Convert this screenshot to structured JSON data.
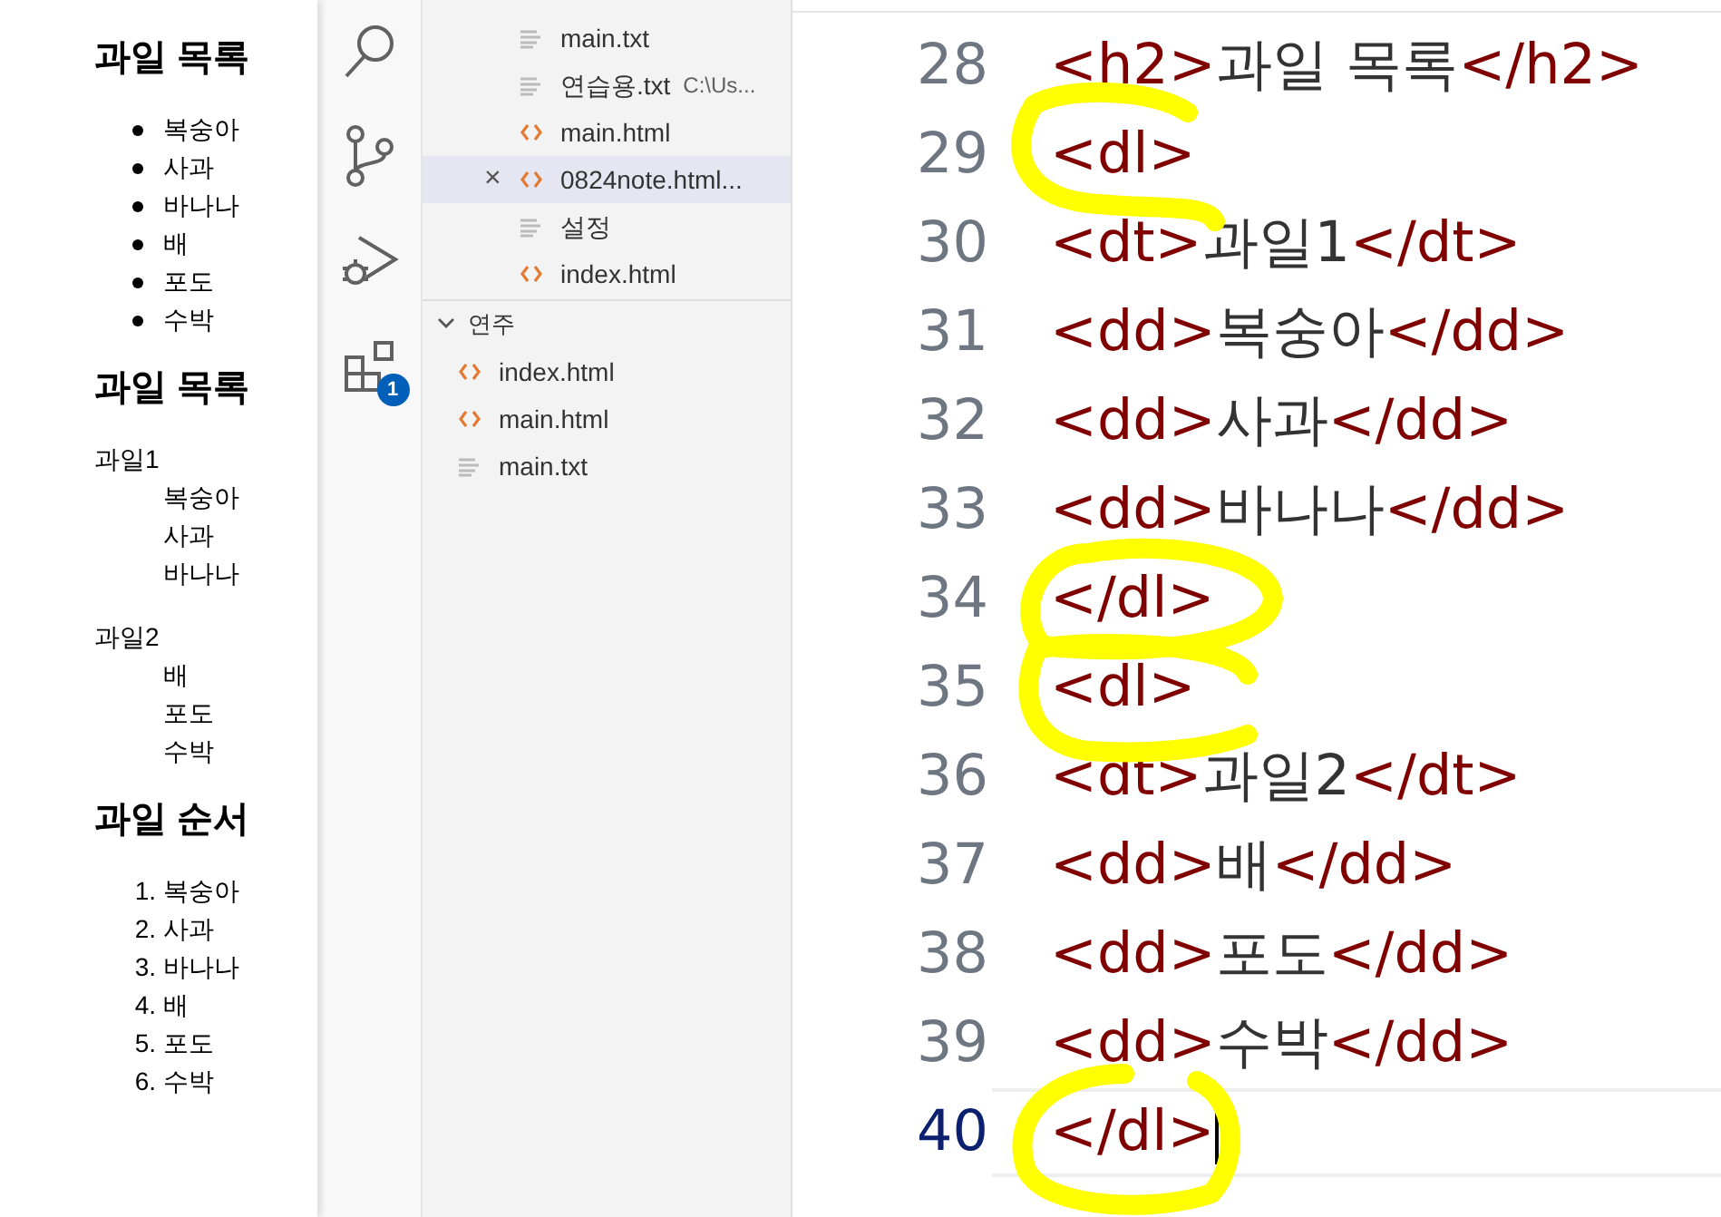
{
  "preview": {
    "sections": [
      {
        "kind": "ul",
        "heading": "과일 목록",
        "items": [
          "복숭아",
          "사과",
          "바나나",
          "배",
          "포도",
          "수박"
        ]
      },
      {
        "kind": "dl",
        "heading": "과일 목록",
        "groups": [
          {
            "term": "과일1",
            "items": [
              "복숭아",
              "사과",
              "바나나"
            ]
          },
          {
            "term": "과일2",
            "items": [
              "배",
              "포도",
              "수박"
            ]
          }
        ]
      },
      {
        "kind": "ol",
        "heading": "과일 순서",
        "items": [
          {
            "number": "1.",
            "text": "복숭아"
          },
          {
            "number": "2.",
            "text": "사과"
          },
          {
            "number": "3.",
            "text": "바나나"
          },
          {
            "number": "4.",
            "text": "배"
          },
          {
            "number": "5.",
            "text": "포도"
          },
          {
            "number": "6.",
            "text": "수박"
          }
        ]
      }
    ]
  },
  "activity_bar": {
    "items": [
      {
        "kind": "search"
      },
      {
        "kind": "source-control"
      },
      {
        "kind": "run-debug"
      },
      {
        "kind": "extensions",
        "badge": "1"
      }
    ]
  },
  "explorer": {
    "open_editors": [
      {
        "kind": "text",
        "name": "main.txt",
        "selected": false
      },
      {
        "kind": "text",
        "name": "연습용.txt",
        "description": "C:\\Us...",
        "selected": false
      },
      {
        "kind": "html",
        "name": "main.html",
        "selected": false
      },
      {
        "kind": "html",
        "name": "0824note.html...",
        "selected": true,
        "close": "×"
      },
      {
        "kind": "text",
        "name": "설정",
        "selected": false
      },
      {
        "kind": "html",
        "name": "index.html",
        "selected": false
      }
    ],
    "folder": {
      "name": "연주",
      "expanded": true,
      "files": [
        {
          "kind": "html",
          "name": "index.html"
        },
        {
          "kind": "html",
          "name": "main.html"
        },
        {
          "kind": "text",
          "name": "main.txt"
        }
      ]
    }
  },
  "editor": {
    "lines": [
      {
        "number": "28",
        "current": false,
        "tokens": [
          {
            "kind": "tag",
            "text": "<h2>"
          },
          {
            "kind": "text",
            "text": "과일 목록"
          },
          {
            "kind": "tag",
            "text": "</h2>"
          }
        ]
      },
      {
        "number": "29",
        "current": false,
        "tokens": [
          {
            "kind": "tag",
            "text": "<dl>"
          }
        ]
      },
      {
        "number": "30",
        "current": false,
        "tokens": [
          {
            "kind": "tag",
            "text": "<dt>"
          },
          {
            "kind": "text",
            "text": "과일1"
          },
          {
            "kind": "tag",
            "text": "</dt>"
          }
        ]
      },
      {
        "number": "31",
        "current": false,
        "tokens": [
          {
            "kind": "tag",
            "text": "<dd>"
          },
          {
            "kind": "text",
            "text": "복숭아"
          },
          {
            "kind": "tag",
            "text": "</dd>"
          }
        ]
      },
      {
        "number": "32",
        "current": false,
        "tokens": [
          {
            "kind": "tag",
            "text": "<dd>"
          },
          {
            "kind": "text",
            "text": "사과"
          },
          {
            "kind": "tag",
            "text": "</dd>"
          }
        ]
      },
      {
        "number": "33",
        "current": false,
        "tokens": [
          {
            "kind": "tag",
            "text": "<dd>"
          },
          {
            "kind": "text",
            "text": "바나나"
          },
          {
            "kind": "tag",
            "text": "</dd>"
          }
        ]
      },
      {
        "number": "34",
        "current": false,
        "tokens": [
          {
            "kind": "tag",
            "text": "</dl>"
          }
        ]
      },
      {
        "number": "35",
        "current": false,
        "tokens": [
          {
            "kind": "tag",
            "text": "<dl>"
          }
        ]
      },
      {
        "number": "36",
        "current": false,
        "tokens": [
          {
            "kind": "tag",
            "text": "<dt>"
          },
          {
            "kind": "text",
            "text": "과일2"
          },
          {
            "kind": "tag",
            "text": "</dt>"
          }
        ]
      },
      {
        "number": "37",
        "current": false,
        "tokens": [
          {
            "kind": "tag",
            "text": "<dd>"
          },
          {
            "kind": "text",
            "text": "배"
          },
          {
            "kind": "tag",
            "text": "</dd>"
          }
        ]
      },
      {
        "number": "38",
        "current": false,
        "tokens": [
          {
            "kind": "tag",
            "text": "<dd>"
          },
          {
            "kind": "text",
            "text": "포도"
          },
          {
            "kind": "tag",
            "text": "</dd>"
          }
        ]
      },
      {
        "number": "39",
        "current": false,
        "tokens": [
          {
            "kind": "tag",
            "text": "<dd>"
          },
          {
            "kind": "text",
            "text": "수박"
          },
          {
            "kind": "tag",
            "text": "</dd>"
          }
        ]
      },
      {
        "number": "40",
        "current": true,
        "tokens": [
          {
            "kind": "tag",
            "text": "</dl>"
          }
        ]
      }
    ]
  }
}
